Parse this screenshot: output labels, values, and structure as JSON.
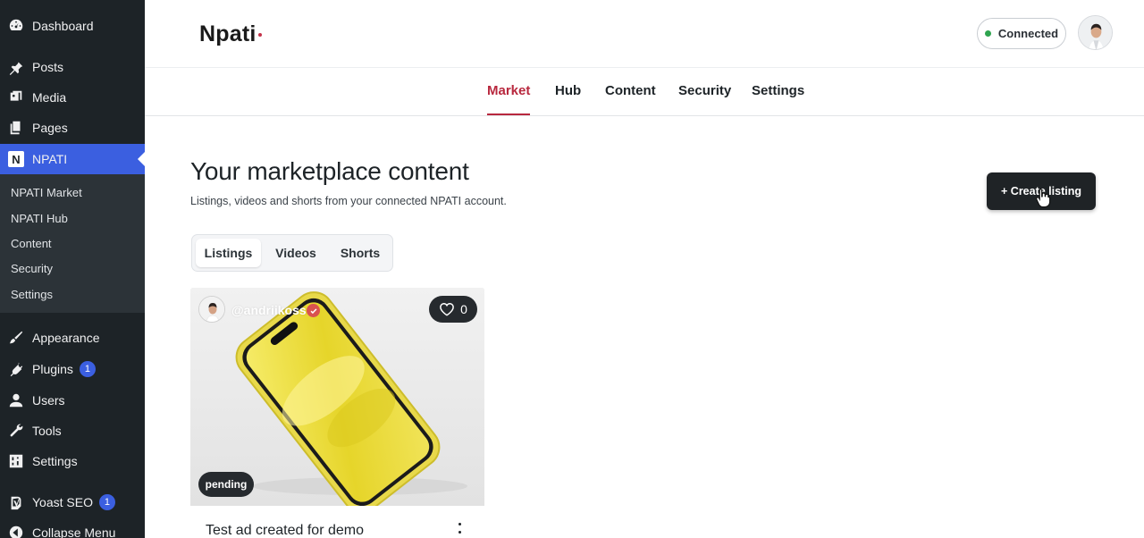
{
  "sidebar": {
    "items": [
      {
        "label": "Dashboard",
        "icon": "dashboard-icon"
      },
      {
        "label": "Posts",
        "icon": "pin-icon"
      },
      {
        "label": "Media",
        "icon": "media-icon"
      },
      {
        "label": "Pages",
        "icon": "pages-icon"
      },
      {
        "label": "NPATI",
        "icon": "npati-logo-icon",
        "logo_letter": "N"
      },
      {
        "label": "Appearance",
        "icon": "brush-icon"
      },
      {
        "label": "Plugins",
        "icon": "plug-icon",
        "badge": "1"
      },
      {
        "label": "Users",
        "icon": "user-icon"
      },
      {
        "label": "Tools",
        "icon": "wrench-icon"
      },
      {
        "label": "Settings",
        "icon": "sliders-icon"
      },
      {
        "label": "Yoast SEO",
        "icon": "yoast-icon",
        "badge": "1"
      },
      {
        "label": "Collapse Menu",
        "icon": "collapse-icon"
      }
    ],
    "submenu": [
      "NPATI Market",
      "NPATI Hub",
      "Content",
      "Security",
      "Settings"
    ]
  },
  "header": {
    "brand": "Npati",
    "status": "Connected"
  },
  "nav": {
    "tabs": [
      "Market",
      "Hub",
      "Content",
      "Security",
      "Settings"
    ],
    "active": "Market"
  },
  "main": {
    "title": "Your marketplace content",
    "subtitle": "Listings, videos and shorts from your connected NPATI account.",
    "create_button": "+ Create listing",
    "segments": [
      "Listings",
      "Videos",
      "Shorts"
    ],
    "active_segment": "Listings"
  },
  "card": {
    "handle": "@andriikoss",
    "likes": "0",
    "status": "pending",
    "title": "Test ad created for demo"
  },
  "colors": {
    "sidebar_bg": "#1d2327",
    "active_menu": "#3b5fe0",
    "accent": "#b8283e",
    "status_green": "#2ea44f"
  }
}
